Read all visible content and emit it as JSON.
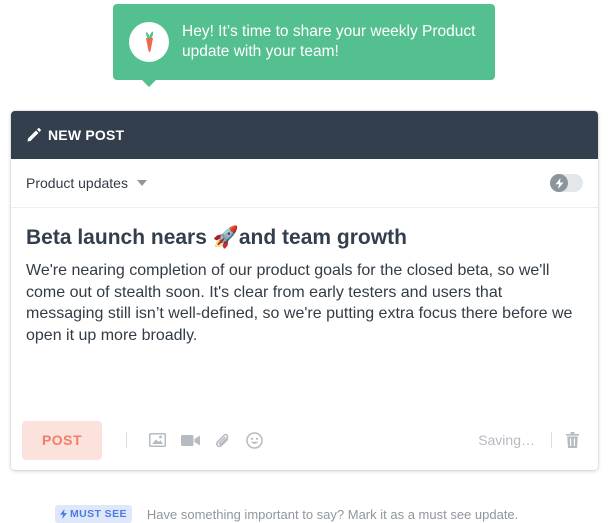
{
  "nudge": {
    "message": "Hey! It’s time to share your weekly Product update with your team!",
    "avatar_icon": "carrot-icon"
  },
  "composer": {
    "header_title": "NEW POST",
    "header_icon": "pencil-icon",
    "channel": "Product updates",
    "toggle_icon": "lightning-icon",
    "toggle_on": false,
    "post_title": "Beta launch nears 🚀and team growth",
    "post_body": "We're nearing completion of our product goals for the closed beta, so we'll come out of stealth soon. It's clear from early testers and users that messaging still isn’t well-defined, so we're putting extra focus there before we open it up more broadly.",
    "post_button": "POST",
    "toolbar_icons": [
      "image-icon",
      "video-icon",
      "attachment-icon",
      "emoji-icon"
    ],
    "status": "Saving…",
    "delete_icon": "trash-icon"
  },
  "hint": {
    "badge": "MUST SEE",
    "text": "Have something important to say? Mark it as a must see update."
  },
  "colors": {
    "nudge_bg": "#54c08f",
    "header_bg": "#333f4d",
    "post_button_bg": "#fce2dd",
    "post_button_text": "#f37d68",
    "badge_bg": "#dfe8fb",
    "badge_text": "#4a7de6"
  }
}
